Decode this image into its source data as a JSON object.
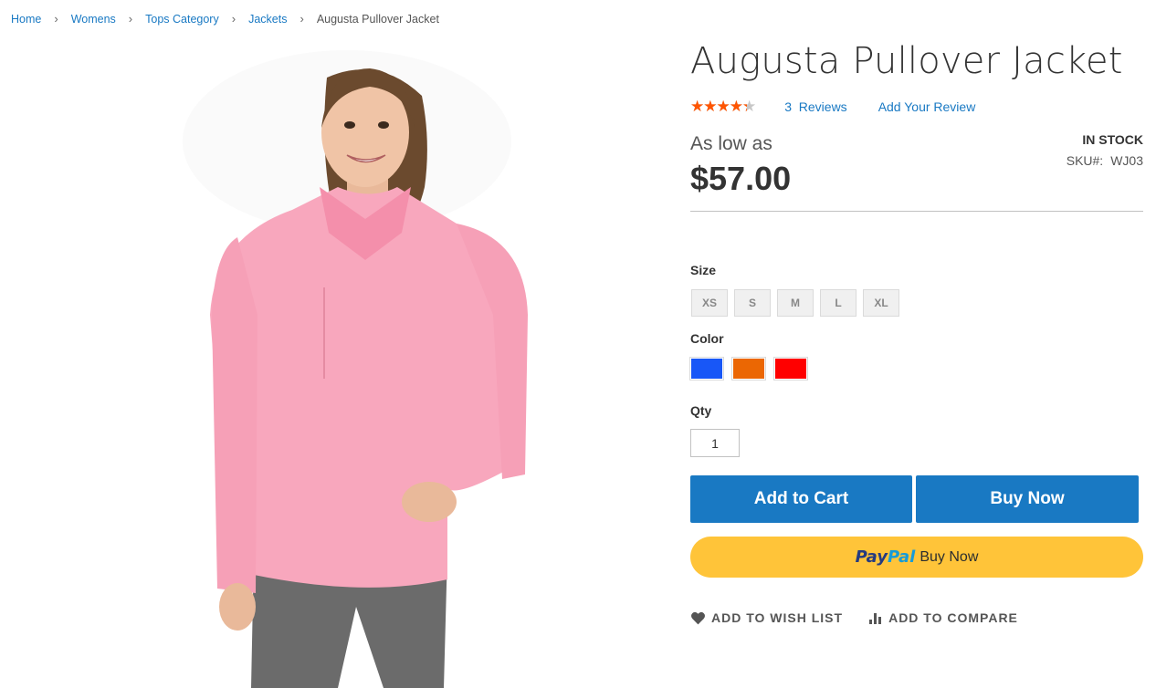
{
  "breadcrumb": {
    "items": [
      "Home",
      "Womens",
      "Tops Category",
      "Jackets"
    ],
    "current": "Augusta Pullover Jacket",
    "separator": "›"
  },
  "product": {
    "title": "Augusta Pullover Jacket",
    "rating_fraction": 0.87,
    "stars_glyph": "★★★★★",
    "review_count": "3",
    "reviews_label": "Reviews",
    "add_review_label": "Add Your Review",
    "price_label": "As low as",
    "price": "$57.00",
    "stock": "IN STOCK",
    "sku_label": "SKU#:",
    "sku": "WJ03"
  },
  "options": {
    "size_label": "Size",
    "sizes": [
      "XS",
      "S",
      "M",
      "L",
      "XL"
    ],
    "color_label": "Color",
    "colors": [
      "#1857f7",
      "#eb6703",
      "#ff0000"
    ],
    "qty_label": "Qty",
    "qty_value": "1"
  },
  "buttons": {
    "add_to_cart": "Add to Cart",
    "buy_now": "Buy Now",
    "paypal_pay": "Pay",
    "paypal_pal": "Pal",
    "paypal_buy": "Buy Now"
  },
  "links": {
    "wishlist": "ADD TO WISH LIST",
    "compare": "ADD TO COMPARE"
  },
  "colors": {
    "link": "#1979c3",
    "button": "#1979c3",
    "paypal": "#ffc439",
    "star": "#ff5501"
  }
}
